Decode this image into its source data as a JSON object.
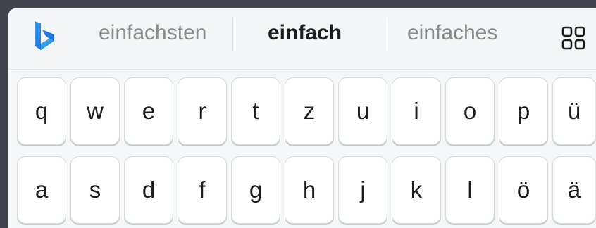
{
  "suggestion_bar": {
    "logo_icon": "bing-logo-icon",
    "left": "einfachsten",
    "middle": "einfach",
    "right": "einfaches",
    "grid_icon": "grid-icon"
  },
  "keyboard": {
    "row1": [
      "q",
      "w",
      "e",
      "r",
      "t",
      "z",
      "u",
      "i",
      "o",
      "p",
      "ü"
    ],
    "row2": [
      "a",
      "s",
      "d",
      "f",
      "g",
      "h",
      "j",
      "k",
      "l",
      "ö",
      "ä"
    ]
  },
  "colors": {
    "background": "#f5f6f8",
    "key": "#ffffff",
    "suggestion_muted": "#8a8a8e",
    "suggestion_active": "#1c1c1e",
    "bing_blue": "#1e88e5"
  }
}
